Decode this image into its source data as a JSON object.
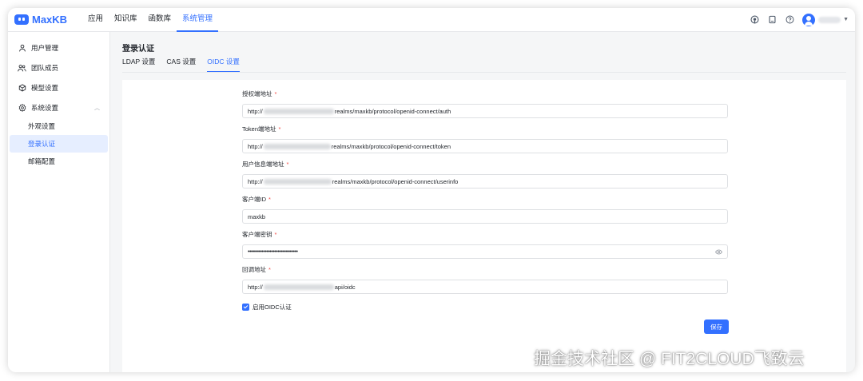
{
  "app": {
    "name": "MaxKB",
    "accent": "#3370ff"
  },
  "topnav": {
    "items": [
      "应用",
      "知识库",
      "函数库",
      "系统管理"
    ],
    "active_index": 3
  },
  "header_icons": [
    "github-icon",
    "document-icon",
    "help-icon"
  ],
  "sidebar": {
    "items": [
      {
        "label": "用户管理",
        "icon": "user-icon"
      },
      {
        "label": "团队成员",
        "icon": "team-icon"
      },
      {
        "label": "模型设置",
        "icon": "cube-icon"
      },
      {
        "label": "系统设置",
        "icon": "gear-icon",
        "expanded": true
      }
    ],
    "sub_items": [
      "外观设置",
      "登录认证",
      "邮箱配置"
    ],
    "active_sub_index": 1
  },
  "page": {
    "title": "登录认证",
    "tabs": [
      "LDAP 设置",
      "CAS 设置",
      "OIDC 设置"
    ],
    "active_tab_index": 2
  },
  "form": {
    "fields": [
      {
        "label": "授权端地址",
        "required": true,
        "prefix": "http://",
        "suffix": "realms/maxkb/protocol/openid-connect/auth"
      },
      {
        "label": "Token端地址",
        "required": true,
        "prefix": "http://",
        "suffix": "realms/maxkb/protocol/openid-connect/token"
      },
      {
        "label": "用户信息端地址",
        "required": true,
        "prefix": "http://",
        "suffix": "realms/maxkb/protocol/openid-connect/userinfo"
      },
      {
        "label": "客户端ID",
        "required": true,
        "value": "maxkb"
      },
      {
        "label": "客户端密钥",
        "required": true,
        "value": "••••••••••••••••••••••••••••••••"
      },
      {
        "label": "回调地址",
        "required": true,
        "prefix": "http://",
        "suffix": "api/oidc"
      }
    ],
    "enable_label": "启用OIDC认证",
    "enable_checked": true,
    "save_label": "保存"
  },
  "watermark": "掘金技术社区 @ FIT2CLOUD飞致云"
}
